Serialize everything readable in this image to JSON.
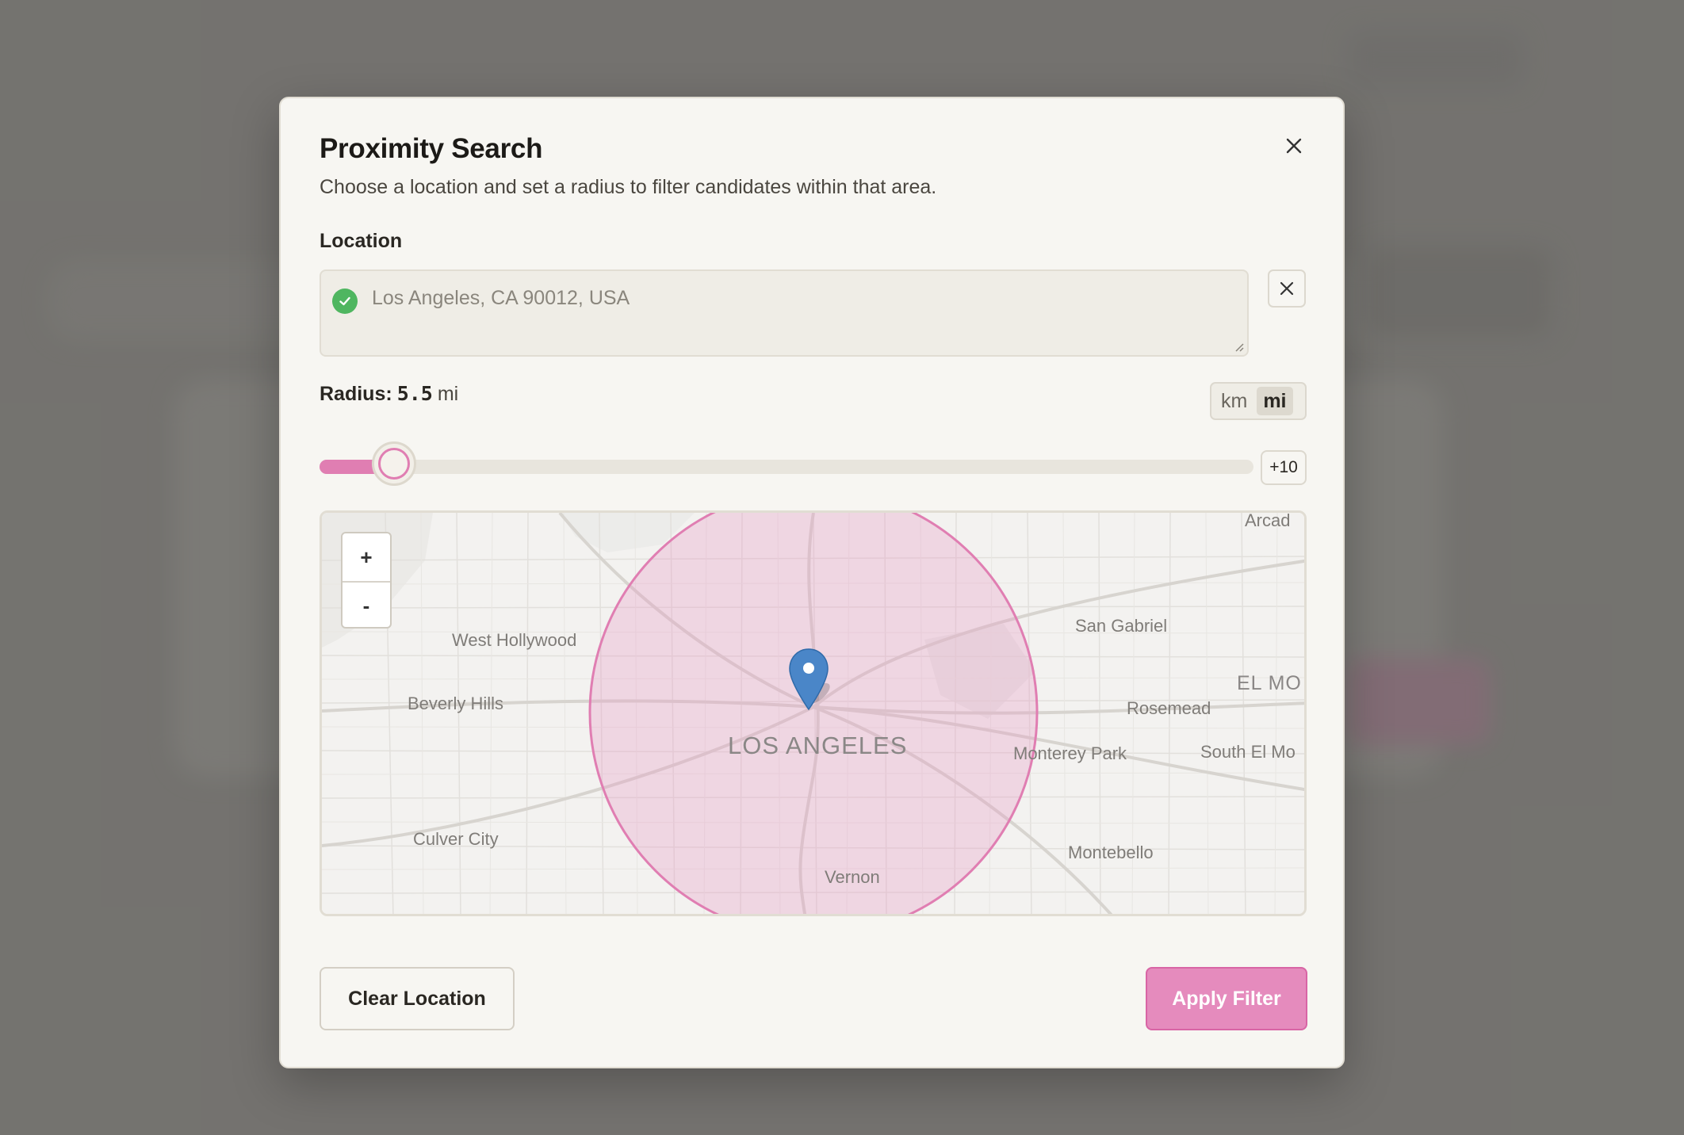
{
  "modal": {
    "title": "Proximity Search",
    "subtitle": "Choose a location and set a radius to filter candidates within that area.",
    "close_icon": "close-icon"
  },
  "location": {
    "label": "Location",
    "value": "Los Angeles, CA 90012, USA",
    "status_icon": "check-circle-icon",
    "clear_icon": "close-icon"
  },
  "radius": {
    "label": "Radius:",
    "value": "5.5",
    "unit": "mi",
    "slider_fraction": 0.08,
    "step_button": "+10"
  },
  "unit_toggle": {
    "options": [
      "km",
      "mi"
    ],
    "selected": "mi"
  },
  "map": {
    "zoom_in": "+",
    "zoom_out": "-",
    "center_label": "LOS ANGELES",
    "labels": {
      "arcadia": "Arcad",
      "west_hollywood": "West Hollywood",
      "san_gabriel": "San Gabriel",
      "beverly_hills": "Beverly Hills",
      "el_monte": "EL MO",
      "rosemead": "Rosemead",
      "monterey_park": "Monterey Park",
      "south_el_monte": "South El Mo",
      "culver_city": "Culver City",
      "montebello": "Montebello",
      "vernon": "Vernon"
    },
    "marker_icon": "map-pin-icon",
    "circle_color": "#e07eb2"
  },
  "actions": {
    "clear": "Clear Location",
    "apply": "Apply Filter"
  },
  "colors": {
    "accent": "#e07eb2",
    "success": "#4fb660",
    "marker": "#4a86c8"
  }
}
